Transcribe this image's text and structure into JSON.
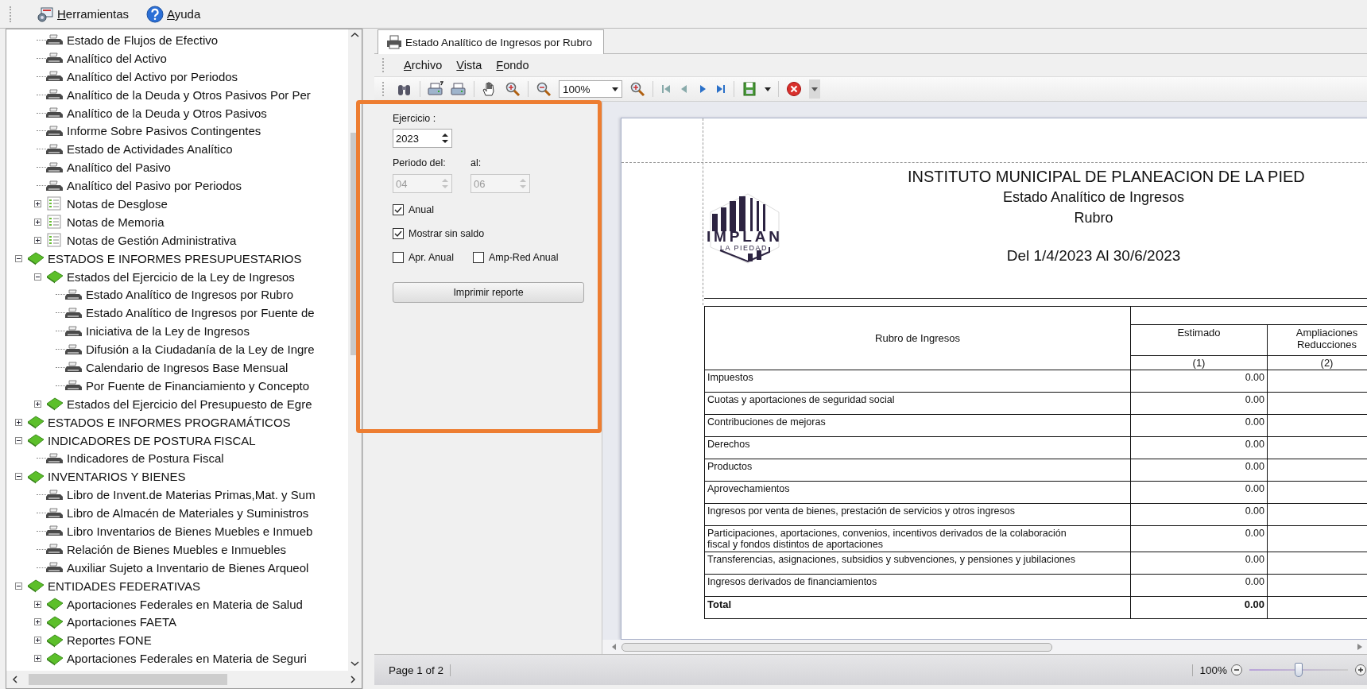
{
  "main_menu": [
    {
      "label": "Herramientas",
      "kind": "tools"
    },
    {
      "label": "Ayuda",
      "kind": "help"
    }
  ],
  "tree": {
    "continued_children": [
      {
        "label": "Estado de Flujos de Efectivo",
        "kind": "report"
      },
      {
        "label": "Analítico del Activo",
        "kind": "report"
      },
      {
        "label": "Analítico del Activo por Periodos",
        "kind": "report"
      },
      {
        "label": "Analítico de la Deuda y Otros Pasivos Por Per",
        "kind": "report"
      },
      {
        "label": "Analítico de la Deuda y Otros Pasivos",
        "kind": "report"
      },
      {
        "label": "Informe Sobre Pasivos Contingentes",
        "kind": "report"
      },
      {
        "label": "Estado de Actividades Analítico",
        "kind": "report"
      },
      {
        "label": "Analítico del Pasivo",
        "kind": "report"
      },
      {
        "label": "Analítico del Pasivo por Periodos",
        "kind": "report"
      },
      {
        "label": "Notas de Desglose",
        "kind": "notes",
        "expanded": false
      },
      {
        "label": "Notas de Memoria",
        "kind": "notes",
        "expanded": false
      },
      {
        "label": "Notas de Gestión Administrativa",
        "kind": "notes",
        "expanded": false
      }
    ],
    "items": [
      {
        "label": "ESTADOS E INFORMES PRESUPUESTARIOS",
        "kind": "folder",
        "expanded": true,
        "children": [
          {
            "label": "Estados del Ejercicio de la Ley de Ingresos",
            "kind": "folder",
            "expanded": true,
            "children": [
              {
                "label": "Estado Analítico de Ingresos por Rubro",
                "kind": "report"
              },
              {
                "label": "Estado Analítico de Ingresos por Fuente de",
                "kind": "report"
              },
              {
                "label": "Iniciativa de la Ley de Ingresos",
                "kind": "report"
              },
              {
                "label": "Difusión a la Ciudadanía de la Ley de Ingre",
                "kind": "report"
              },
              {
                "label": "Calendario de Ingresos Base Mensual",
                "kind": "report"
              },
              {
                "label": "Por Fuente de Financiamiento y Concepto",
                "kind": "report"
              }
            ]
          },
          {
            "label": "Estados del Ejercicio del Presupuesto de Egre",
            "kind": "folder",
            "expanded": false
          }
        ]
      },
      {
        "label": "ESTADOS E INFORMES PROGRAMÁTICOS",
        "kind": "folder",
        "expanded": false
      },
      {
        "label": "INDICADORES DE POSTURA FISCAL",
        "kind": "folder",
        "expanded": true,
        "children": [
          {
            "label": "Indicadores de Postura Fiscal",
            "kind": "report"
          }
        ]
      },
      {
        "label": "INVENTARIOS Y BIENES",
        "kind": "folder",
        "expanded": true,
        "children": [
          {
            "label": "Libro de Invent.de Materias Primas,Mat. y Sum",
            "kind": "report"
          },
          {
            "label": "Libro de Almacén de Materiales y Suministros",
            "kind": "report"
          },
          {
            "label": "Libro Inventarios de Bienes Muebles e Inmueb",
            "kind": "report"
          },
          {
            "label": "Relación de Bienes Muebles e Inmuebles",
            "kind": "report"
          },
          {
            "label": "Auxiliar Sujeto a Inventario de Bienes Arqueol",
            "kind": "report"
          }
        ]
      },
      {
        "label": "ENTIDADES FEDERATIVAS",
        "kind": "folder",
        "expanded": true,
        "children": [
          {
            "label": "Aportaciones Federales en Materia de Salud",
            "kind": "folder",
            "expanded": false
          },
          {
            "label": "Aportaciones FAETA",
            "kind": "folder",
            "expanded": false
          },
          {
            "label": "Reportes FONE",
            "kind": "folder",
            "expanded": false
          },
          {
            "label": "Aportaciones Federales en Materia de Seguri",
            "kind": "folder",
            "expanded": false
          }
        ]
      }
    ]
  },
  "document_tab": {
    "title": "Estado Analítico de Ingresos por Rubro"
  },
  "viewer_menu": [
    "Archivo",
    "Vista",
    "Fondo"
  ],
  "viewer_toolbar": {
    "zoom": "100%"
  },
  "parameters": {
    "year_label": "Ejercicio :",
    "year": "2023",
    "period_from_label": "Periodo del:",
    "period_to_label": "al:",
    "period_from": "04",
    "period_to": "06",
    "period_disabled": true,
    "checkboxes": [
      {
        "label": "Anual",
        "checked": true
      },
      {
        "label": "Mostrar sin saldo",
        "checked": true
      },
      {
        "label": "Apr. Anual",
        "checked": false
      },
      {
        "label": "Amp-Red Anual",
        "checked": false
      }
    ],
    "print_button": "Imprimir reporte"
  },
  "report": {
    "title": "INSTITUTO MUNICIPAL DE PLANEACION DE LA PIED",
    "subtitle": "Estado Analítico de Ingresos",
    "subtitle_2": "Rubro",
    "period": "Del 1/4/2023 Al 30/6/2023",
    "logo": {
      "name": "IMPLAN",
      "tagline": "LA PIEDAD"
    },
    "columns": [
      {
        "lines": [
          "Rubro de Ingresos"
        ]
      },
      {
        "lines": [
          "Estimado"
        ],
        "number": "(1)"
      },
      {
        "lines": [
          "Ampliaciones",
          "Reducciones"
        ],
        "number": "(2)"
      }
    ],
    "rows": [
      {
        "label": "Impuestos",
        "values": [
          "0.00"
        ]
      },
      {
        "label": "Cuotas y aportaciones de seguridad social",
        "values": [
          "0.00"
        ]
      },
      {
        "label": "Contribuciones de mejoras",
        "values": [
          "0.00"
        ]
      },
      {
        "label": "Derechos",
        "values": [
          "0.00"
        ]
      },
      {
        "label": "Productos",
        "values": [
          "0.00"
        ]
      },
      {
        "label": "Aprovechamientos",
        "values": [
          "0.00"
        ]
      },
      {
        "label": "Ingresos por venta de bienes, prestación de servicios y otros ingresos",
        "values": [
          "0.00"
        ]
      },
      {
        "label": "Participaciones, aportaciones, convenios, incentivos derivados de la colaboración fiscal y fondos distintos de aportaciones",
        "values": [
          "0.00"
        ]
      },
      {
        "label": "Transferencias, asignaciones, subsidios y subvenciones, y pensiones y jubilaciones",
        "values": [
          "0.00"
        ]
      },
      {
        "label": "Ingresos derivados de financiamientos",
        "values": [
          "0.00"
        ]
      }
    ],
    "total": {
      "label": "Total",
      "values": [
        "0.00"
      ]
    }
  },
  "status_bar": {
    "page": "Page 1 of 2",
    "zoom": "100%",
    "zoom_slider": {
      "level": 0.5
    }
  }
}
